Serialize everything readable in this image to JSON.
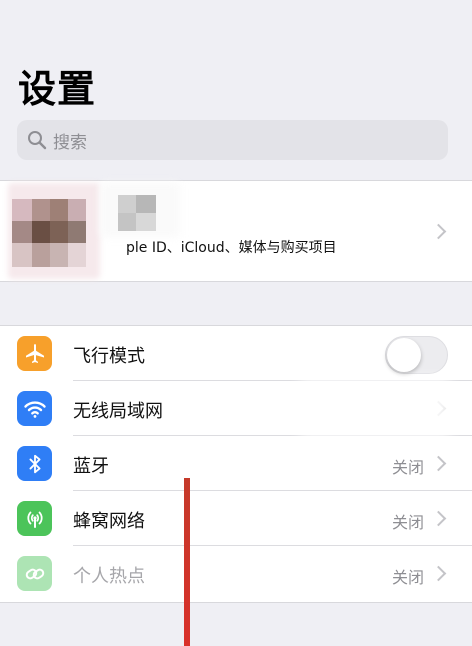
{
  "page": {
    "title": "设置"
  },
  "search": {
    "placeholder": "搜索"
  },
  "profile": {
    "subtitle": "ple ID、iCloud、媒体与购买项目",
    "avatar_icon": "blurred-avatar"
  },
  "settings": {
    "rows": [
      {
        "label": "飞行模式",
        "value": "",
        "icon": "airplane-icon",
        "color": "#f7a02b",
        "control": "toggle",
        "toggle_on": false
      },
      {
        "label": "无线局域网",
        "value": "",
        "icon": "wifi-icon",
        "color": "#2f7ef6",
        "control": "chevron"
      },
      {
        "label": "蓝牙",
        "value": "关闭",
        "icon": "bluetooth-icon",
        "color": "#2f7ef6",
        "control": "chevron"
      },
      {
        "label": "蜂窝网络",
        "value": "关闭",
        "icon": "cellular-antenna-icon",
        "color": "#4cc45a",
        "control": "chevron"
      },
      {
        "label": "个人热点",
        "value": "关闭",
        "icon": "hotspot-link-icon",
        "color": "#4cc45a",
        "control": "chevron",
        "dimmed": true
      }
    ]
  },
  "annotation": {
    "arrow_color": "#d9302a"
  }
}
